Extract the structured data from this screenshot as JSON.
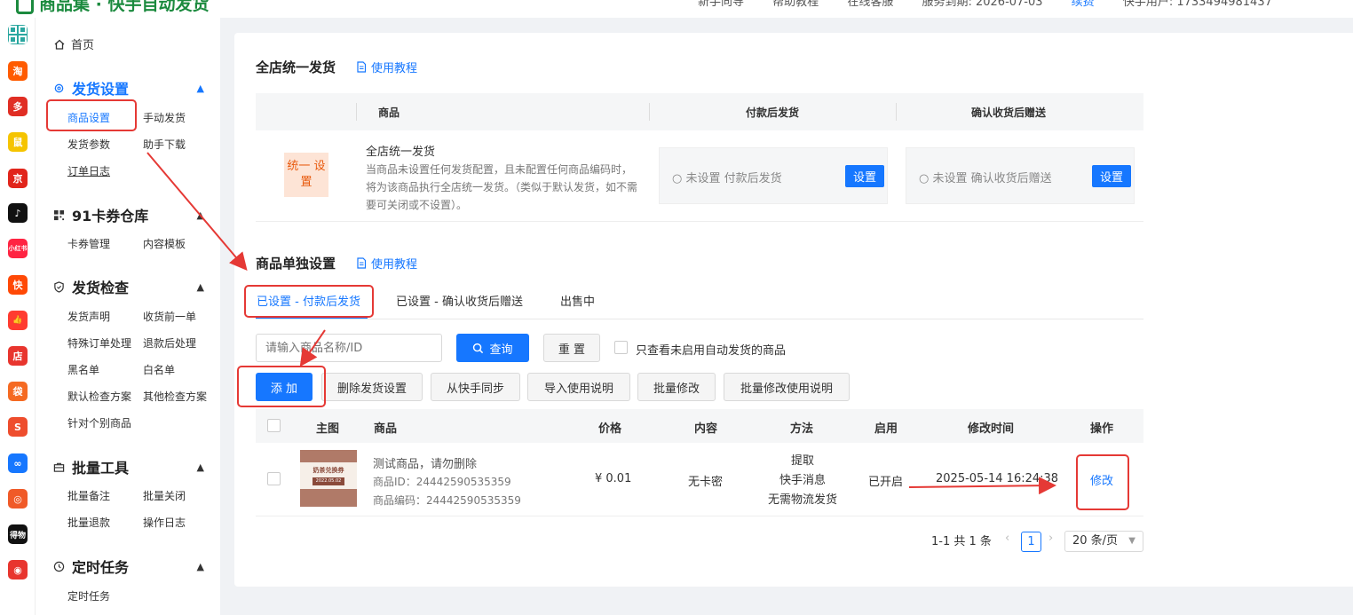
{
  "header": {
    "brand": "商品集 · 快手自动发货",
    "links": [
      "新手向导",
      "帮助教程",
      "在线客服",
      "服务到期: 2026-07-03",
      "续费",
      "快手用户: 1733494981437"
    ],
    "colors": {
      "brand": "#1b8a3e",
      "accent": "#1677ff"
    }
  },
  "rail": [
    {
      "name": "app-grid-icon",
      "label": "",
      "color": "#2aa7a0"
    },
    {
      "name": "taobao-icon",
      "label": "淘",
      "color": "#ff5b00"
    },
    {
      "name": "pinduoduo-icon",
      "label": "多",
      "color": "#e02e24"
    },
    {
      "name": "app-icon-3",
      "label": "鼠",
      "color": "#f5c400"
    },
    {
      "name": "jd-icon",
      "label": "京",
      "color": "#e1251b"
    },
    {
      "name": "douyin-icon",
      "label": "♪",
      "color": "#111111"
    },
    {
      "name": "xiaohongshu-icon",
      "label": "小红书",
      "color": "#ff2442"
    },
    {
      "name": "kuaishou-icon",
      "label": "快",
      "color": "#ff4906"
    },
    {
      "name": "thumb-icon",
      "label": "👍",
      "color": "#ff3b30"
    },
    {
      "name": "store-icon",
      "label": "店",
      "color": "#e8352e"
    },
    {
      "name": "shop-bag-icon",
      "label": "袋",
      "color": "#f56a22"
    },
    {
      "name": "shopee-icon",
      "label": "S",
      "color": "#ee4d2d"
    },
    {
      "name": "link-icon",
      "label": "∞",
      "color": "#1677ff"
    },
    {
      "name": "app-icon-13",
      "label": "◎",
      "color": "#f05a28"
    },
    {
      "name": "dewu-icon",
      "label": "得物",
      "color": "#111111"
    },
    {
      "name": "app-icon-15",
      "label": "◉",
      "color": "#e8352e"
    }
  ],
  "sidebar": {
    "home": "首页",
    "groups": [
      {
        "title": "发货设置",
        "icon": "gear-icon",
        "active": true,
        "items": [
          "商品设置",
          "手动发货",
          "发货参数",
          "助手下载",
          "订单日志"
        ]
      },
      {
        "title": "91卡券仓库",
        "icon": "qr-icon",
        "items": [
          "卡券管理",
          "内容模板"
        ]
      },
      {
        "title": "发货检查",
        "icon": "shield-icon",
        "items": [
          "发货声明",
          "收货前一单",
          "特殊订单处理",
          "退款后处理",
          "黑名单",
          "白名单",
          "默认检查方案",
          "其他检查方案",
          "针对个别商品"
        ]
      },
      {
        "title": "批量工具",
        "icon": "toolbox-icon",
        "items": [
          "批量备注",
          "批量关闭",
          "批量退款",
          "操作日志"
        ]
      },
      {
        "title": "定时任务",
        "icon": "clock-icon",
        "items": [
          "定时任务"
        ]
      }
    ]
  },
  "global": {
    "title": "全店统一发货",
    "tutorial": "使用教程",
    "columns": [
      "商品",
      "付款后发货",
      "确认收货后赠送"
    ],
    "badge": "统一 设置",
    "row_title": "全店统一发货",
    "row_desc": "当商品未设置任何发货配置，且未配置任何商品编码时，将为该商品执行全店统一发货。（类似于默认发货，如不需要可关闭或不设置）。",
    "pay_status": "未设置 付款后发货",
    "receipt_status": "未设置 确认收货后赠送",
    "set_btn": "设置"
  },
  "single": {
    "title": "商品单独设置",
    "tutorial": "使用教程",
    "tabs": [
      "已设置 - 付款后发货",
      "已设置 - 确认收货后赠送",
      "出售中"
    ],
    "search_placeholder": "请输入商品名称/ID",
    "query_btn": "查询",
    "reset_btn": "重 置",
    "only_disabled": "只查看未启用自动发货的商品",
    "actions": {
      "add": "添 加",
      "delete": "删除发货设置",
      "sync": "从快手同步",
      "import": "导入使用说明",
      "batch_edit": "批量修改",
      "batch_help": "批量修改使用说明"
    },
    "columns": [
      "主图",
      "商品",
      "价格",
      "内容",
      "方法",
      "启用",
      "修改时间",
      "操作"
    ],
    "rows": [
      {
        "thumb_title": "奶茶兑换券",
        "thumb_date": "2022.05.02",
        "name": "测试商品，请勿删除",
        "id_text": "商品ID：24442590535359",
        "code_text": "商品编码：24442590535359",
        "price": "¥ 0.01",
        "content": "无卡密",
        "method": [
          "提取",
          "快手消息",
          "无需物流发货"
        ],
        "enabled": "已开启",
        "modified": "2025-05-14 16:24:38",
        "action": "修改"
      }
    ],
    "pager": {
      "summary": "1-1 共 1 条",
      "current": "1",
      "page_size": "20 条/页"
    }
  },
  "annotation_color": "#e53935"
}
